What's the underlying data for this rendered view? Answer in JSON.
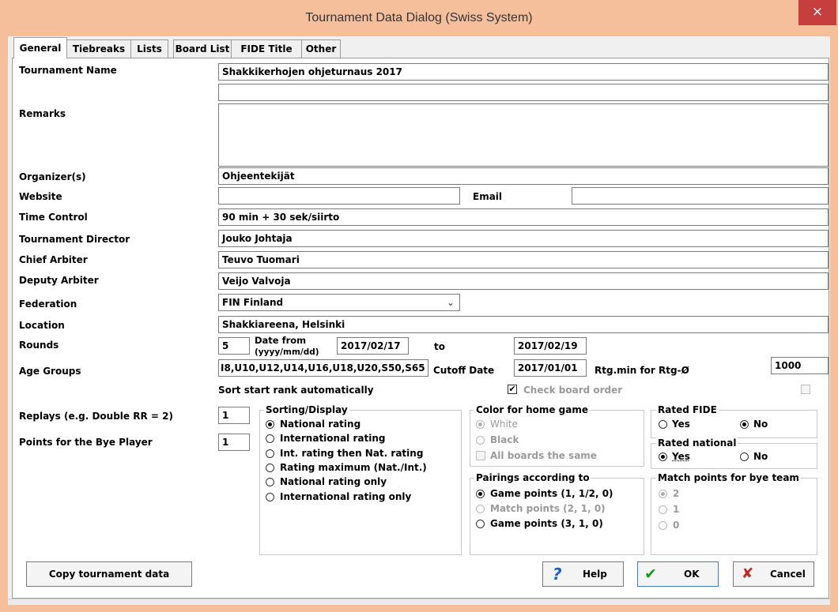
{
  "window": {
    "title": "Tournament Data Dialog (Swiss System)",
    "close_glyph": "×"
  },
  "tabs": [
    "General",
    "Tiebreaks",
    "Lists",
    "Board List",
    "FIDE Title",
    "Other"
  ],
  "labels": {
    "tournament_name": "Tournament Name",
    "remarks": "Remarks",
    "organizers": "Organizer(s)",
    "website": "Website",
    "email": "Email",
    "time_control": "Time Control",
    "tournament_director": "Tournament Director",
    "chief_arbiter": "Chief Arbiter",
    "deputy_arbiter": "Deputy Arbiter",
    "federation": "Federation",
    "location": "Location",
    "rounds": "Rounds",
    "date_from": "Date from",
    "date_format": "(yyyy/mm/dd)",
    "to": "to",
    "age_groups": "Age Groups",
    "cutoff_date": "Cutoff Date",
    "rtg_min": "Rtg.min for Rtg-Ø",
    "sort_start_rank": "Sort start rank automatically",
    "check_board_order": "Check board order",
    "replays": "Replays (e.g. Double RR = 2)",
    "points_bye": "Points for the Bye Player"
  },
  "fields": {
    "tournament_name": "Shakkikerhojen ohjeturnaus 2017",
    "tournament_name_2": "",
    "remarks": "",
    "organizers": "Ohjeentekijät",
    "website": "",
    "email": "",
    "time_control": "90 min + 30 sek/siirto",
    "tournament_director": "Jouko Johtaja",
    "chief_arbiter": "Teuvo Tuomari",
    "deputy_arbiter": "Veijo Valvoja",
    "federation": "FIN Finland",
    "location": "Shakkiareena, Helsinki",
    "rounds": "5",
    "date_from": "2017/02/17",
    "date_to": "2017/02/19",
    "age_groups": "I8,U10,U12,U14,U16,U18,U20,S50,S65",
    "cutoff_date": "2017/01/01",
    "rtg_min": "1000",
    "replays": "1",
    "points_bye": "1"
  },
  "sorting": {
    "title": "Sorting/Display",
    "options": [
      "National rating",
      "International rating",
      "Int. rating then Nat. rating",
      "Rating maximum (Nat./Int.)",
      "National rating only",
      "International rating only"
    ],
    "selected": 0
  },
  "color_home": {
    "title": "Color for home game",
    "options": [
      "White",
      "Black"
    ],
    "all_boards": "All boards the same"
  },
  "pairings": {
    "title": "Pairings according to",
    "options": [
      "Game points (1, 1/2, 0)",
      "Match points (2, 1, 0)",
      "Game points (3, 1, 0)"
    ]
  },
  "rated_fide": {
    "title": "Rated FIDE",
    "yes": "Yes",
    "no": "No"
  },
  "rated_national": {
    "title": "Rated national",
    "yes": "Yes",
    "no": "No"
  },
  "match_bye": {
    "title": "Match points for bye team",
    "options": [
      "2",
      "1",
      "0"
    ]
  },
  "buttons": {
    "copy": "Copy tournament data",
    "help": "Help",
    "ok": "OK",
    "cancel": "Cancel",
    "help_glyph": "?",
    "ok_glyph": "✔",
    "cancel_glyph": "✘"
  },
  "icons": [
    "close-icon",
    "chevron-down-icon",
    "help-icon",
    "check-icon",
    "cancel-x-icon"
  ],
  "colors": {
    "titlebar": "#f6bf9c",
    "close": "#c73e3e",
    "help_icon": "#1d5fc9",
    "ok_icon": "#1c9a1c",
    "cancel_icon": "#c42424"
  }
}
